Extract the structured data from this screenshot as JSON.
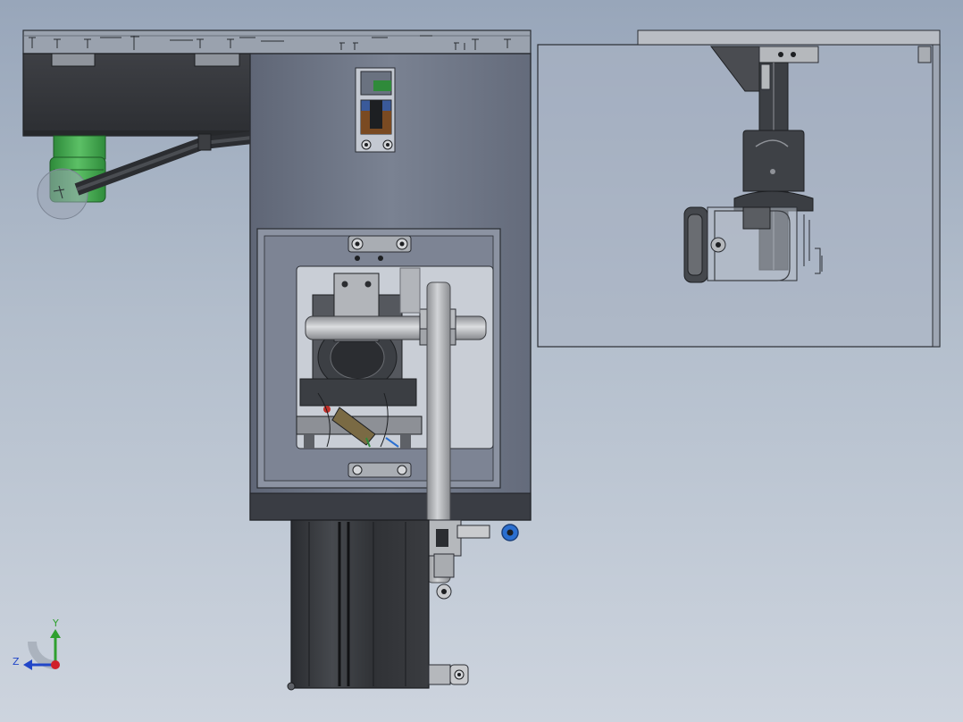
{
  "viewport": {
    "background_top": "#98a6ba",
    "background_bottom": "#cdd4de",
    "view": "CAD model view"
  },
  "triad": {
    "y_label": "Y",
    "z_label": "Z",
    "y_color": "#2fa02f",
    "z_color": "#2146c8",
    "x_color": "#d0202a"
  },
  "colors": {
    "housing": "#6f7787",
    "housing_edge": "#2a2d33",
    "dark_block": "#35373b",
    "motor_green": "#3fa64a",
    "steel": "#a9abae",
    "accent_blue": "#2a6fd0",
    "accent_brown": "#7a4a22",
    "glass": "#b8bfcc"
  },
  "icons": {
    "triad": "axis-triad-icon",
    "rotate_handle": "rotate-handle-icon"
  }
}
